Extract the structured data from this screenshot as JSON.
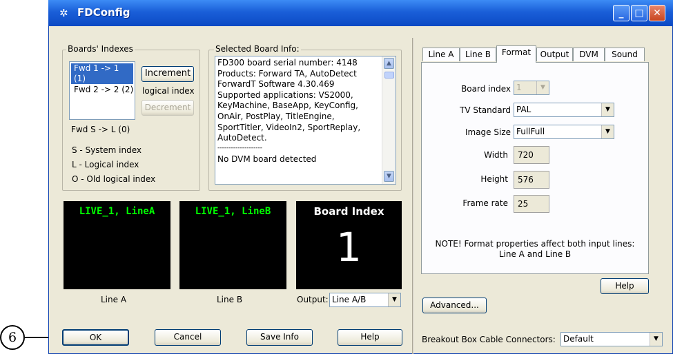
{
  "window": {
    "title": "FDConfig"
  },
  "boards": {
    "group_title": "Boards' Indexes",
    "list": [
      "Fwd 1 -> 1 (1)",
      "Fwd 2 -> 2 (2)"
    ],
    "increment_label": "Increment",
    "logical_index_label": "logical index",
    "decrement_label": "Decrement",
    "system_line": "Fwd S -> L (0)",
    "legend": [
      "S - System index",
      "L - Logical index",
      "O - Old logical index"
    ]
  },
  "board_info": {
    "group_title": "Selected Board Info:",
    "lines": [
      "FD300 board serial number: 4148",
      "Products: Forward TA, AutoDetect",
      "ForwardT Software 4.30.469",
      "Supported applications: VS2000,",
      "KeyMachine, BaseApp, KeyConfig,",
      "OnAir, PostPlay, TitleEngine,",
      "SportTitler, VideoIn2, SportReplay,",
      "AutoDetect.",
      "--------------------",
      "No DVM board detected"
    ]
  },
  "monitors": [
    {
      "title": "LIVE_1, LineA",
      "caption": "Line A",
      "color": "#00ff00"
    },
    {
      "title": "LIVE_1, LineB",
      "caption": "Line B",
      "color": "#00ff00"
    },
    {
      "title": "Board Index",
      "big": "1",
      "color": "#ffffff"
    }
  ],
  "output": {
    "label": "Output:",
    "value": "Line A/B"
  },
  "bottom_buttons": {
    "ok": "OK",
    "cancel": "Cancel",
    "save_info": "Save Info",
    "help": "Help"
  },
  "tabs": [
    "Line A",
    "Line B",
    "Format",
    "Output",
    "DVM",
    "Sound"
  ],
  "active_tab": "Format",
  "format": {
    "board_index_label": "Board index",
    "board_index_value": "1",
    "tv_standard_label": "TV Standard",
    "tv_standard_value": "PAL",
    "image_size_label": "Image Size",
    "image_size_value": "FullFull",
    "width_label": "Width",
    "width_value": "720",
    "height_label": "Height",
    "height_value": "576",
    "frame_rate_label": "Frame rate",
    "frame_rate_value": "25",
    "note_line1": "NOTE! Format properties affect both input lines:",
    "note_line2": "Line A and Line B"
  },
  "right_buttons": {
    "help": "Help",
    "advanced": "Advanced..."
  },
  "breakout": {
    "label": "Breakout Box Cable Connectors:",
    "value": "Default"
  },
  "callout": {
    "number": "6"
  }
}
